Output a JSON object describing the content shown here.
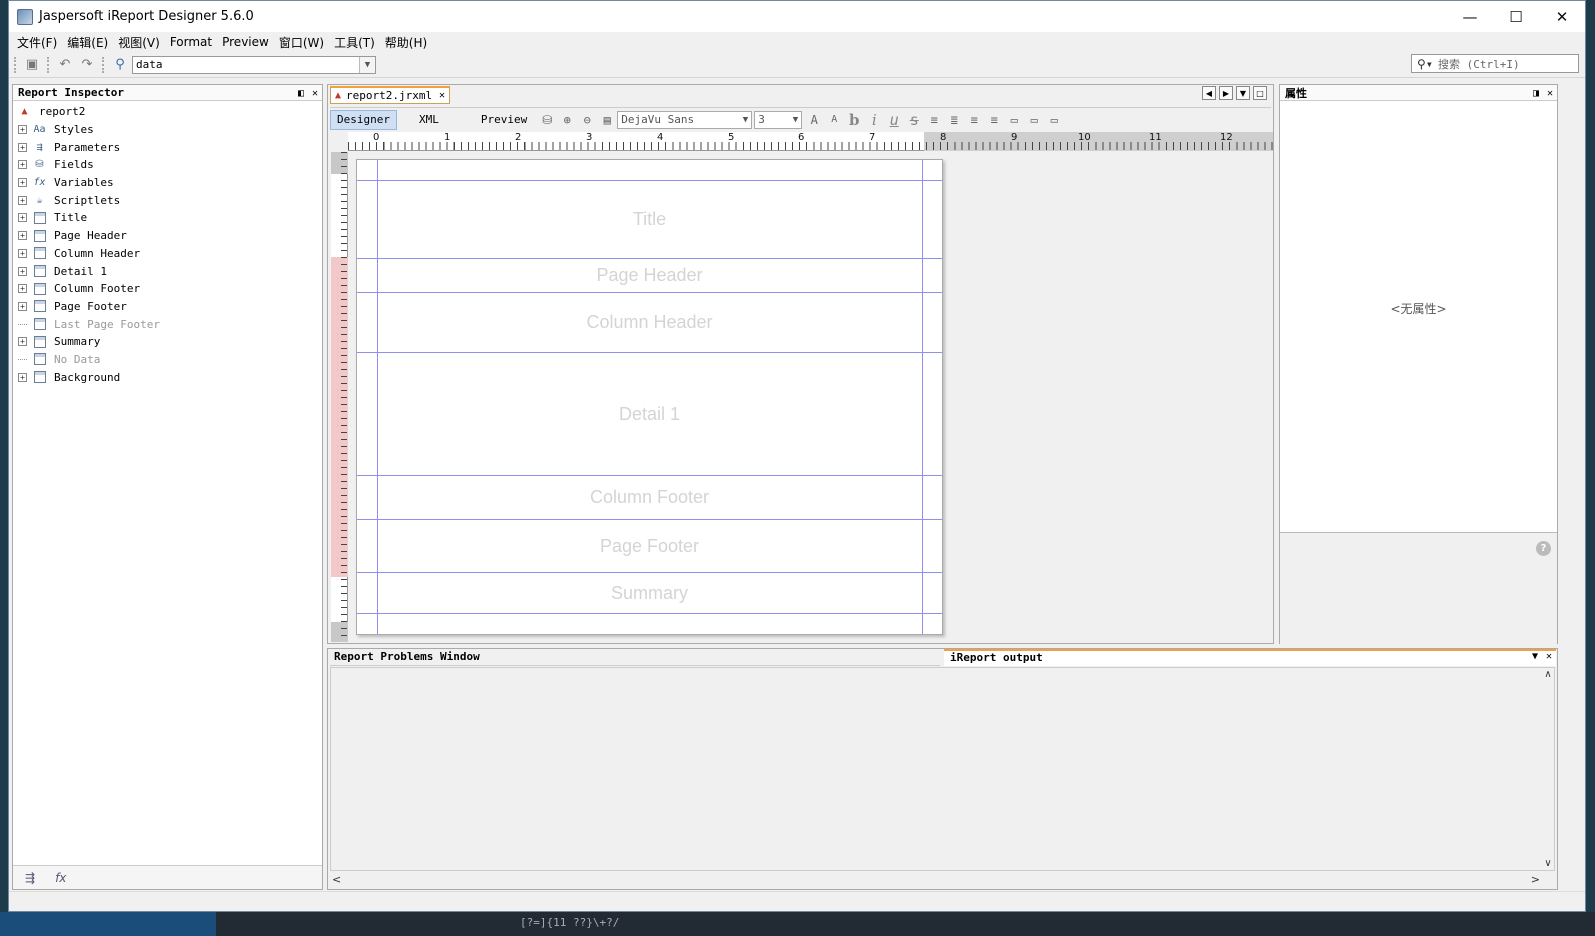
{
  "window": {
    "title": "Jaspersoft iReport Designer 5.6.0",
    "controls": {
      "minimize": "—",
      "maximize": "☐",
      "close": "✕"
    }
  },
  "menu": [
    "文件(F)",
    "编辑(E)",
    "视图(V)",
    "Format",
    "Preview",
    "窗口(W)",
    "工具(T)",
    "帮助(H)"
  ],
  "toolbar": {
    "datasource_value": "data",
    "search_placeholder": "搜索 (Ctrl+I)"
  },
  "inspector": {
    "title": "Report Inspector",
    "root": "report2",
    "items": [
      {
        "label": "Styles",
        "icon": "styles-icon",
        "expandable": true,
        "dim": false
      },
      {
        "label": "Parameters",
        "icon": "parameters-icon",
        "expandable": true,
        "dim": false
      },
      {
        "label": "Fields",
        "icon": "fields-icon",
        "expandable": true,
        "dim": false
      },
      {
        "label": "Variables",
        "icon": "variables-icon",
        "expandable": true,
        "dim": false
      },
      {
        "label": "Scriptlets",
        "icon": "scriptlets-icon",
        "expandable": true,
        "dim": false
      },
      {
        "label": "Title",
        "icon": "band-icon",
        "expandable": true,
        "dim": false
      },
      {
        "label": "Page Header",
        "icon": "band-icon",
        "expandable": true,
        "dim": false
      },
      {
        "label": "Column Header",
        "icon": "band-icon",
        "expandable": true,
        "dim": false
      },
      {
        "label": "Detail 1",
        "icon": "band-icon",
        "expandable": true,
        "dim": false
      },
      {
        "label": "Column Footer",
        "icon": "band-icon",
        "expandable": true,
        "dim": false
      },
      {
        "label": "Page Footer",
        "icon": "band-icon",
        "expandable": true,
        "dim": false
      },
      {
        "label": "Last Page Footer",
        "icon": "band-icon",
        "expandable": false,
        "dim": true
      },
      {
        "label": "Summary",
        "icon": "band-icon",
        "expandable": true,
        "dim": false
      },
      {
        "label": "No Data",
        "icon": "band-icon",
        "expandable": false,
        "dim": true
      },
      {
        "label": "Background",
        "icon": "band-icon",
        "expandable": true,
        "dim": false
      }
    ]
  },
  "editor": {
    "tab": "report2.jrxml",
    "modes": [
      "Designer",
      "XML",
      "Preview"
    ],
    "active_mode": "Designer",
    "font_name": "DejaVu Sans",
    "font_size": "3",
    "ruler_labels": [
      "0",
      "1",
      "2",
      "3",
      "4",
      "5",
      "6",
      "7",
      "8",
      "9",
      "10",
      "11",
      "12"
    ],
    "bands": [
      "Title",
      "Page Header",
      "Column Header",
      "Detail 1",
      "Column Footer",
      "Page Footer",
      "Summary"
    ]
  },
  "properties": {
    "title": "属性",
    "empty_text": "<无属性>"
  },
  "bottom": {
    "problems_tab": "Report Problems Window",
    "output_tab": "iReport output"
  },
  "taskbar": {
    "code_snippet": "[?=]{11 ??}\\+?/"
  }
}
